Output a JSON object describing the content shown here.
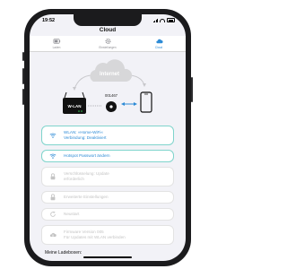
{
  "status_bar": {
    "time": "19:52"
  },
  "app": {
    "title": "Cloud"
  },
  "tabs": [
    {
      "label": "Laden",
      "icon": "battery-icon",
      "active": false
    },
    {
      "label": "Einstellungen",
      "icon": "gear-icon",
      "active": false
    },
    {
      "label": "Cloud",
      "icon": "cloud-icon",
      "active": true
    }
  ],
  "diagram": {
    "cloud_label": "Internet",
    "device_id": "001467",
    "router_label": "W-LAN"
  },
  "menu": [
    {
      "line1": "WLAN: »Home-WiFi«",
      "line2": "Verbindung: Deaktiviert",
      "icon": "wifi-icon",
      "enabled": true
    },
    {
      "line1": "Hotspot Passwort ändern",
      "line2": "",
      "icon": "wifi-icon",
      "enabled": true
    },
    {
      "line1": "Verschlüsselung: Update",
      "line2": "erforderlich",
      "icon": "lock-icon",
      "enabled": false
    },
    {
      "line1": "Erweiterte Einstellungen",
      "line2": "",
      "icon": "lock-icon",
      "enabled": false
    },
    {
      "line1": "Neustart",
      "line2": "",
      "icon": "refresh-icon",
      "enabled": false
    },
    {
      "line1": "Firmware Version 005",
      "line2": "Für Updates mit WLAN verbinden",
      "icon": "cloud-download-icon",
      "enabled": false
    }
  ],
  "section": {
    "my_chargers_label": "Meine Ladeboxen:"
  },
  "colors": {
    "accent": "#2d8bd6",
    "item_border": "#7fd4cc",
    "disabled_text": "#c4c4c4",
    "cloud": "#d7d7d9"
  }
}
